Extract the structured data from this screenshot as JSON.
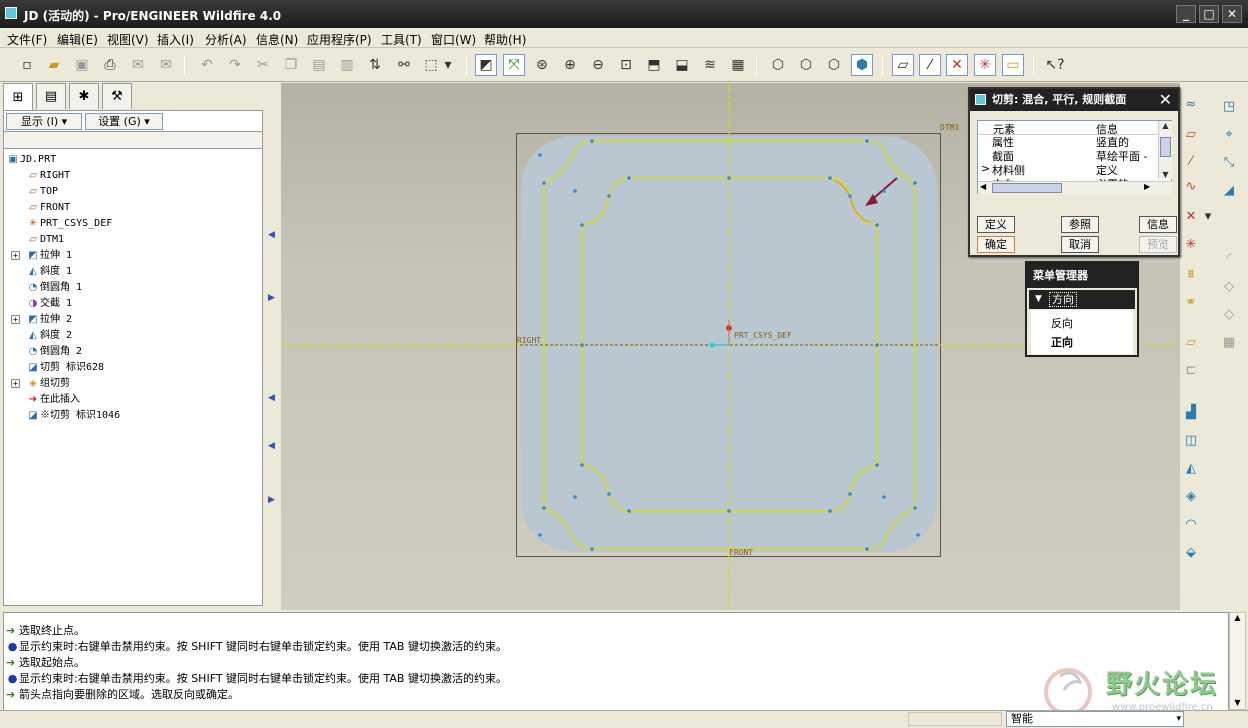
{
  "window": {
    "title": "JD (活动的) - Pro/ENGINEER Wildfire 4.0",
    "minimize": "_",
    "maximize": "□",
    "close": "✕"
  },
  "menu": [
    "文件(F)",
    "编辑(E)",
    "视图(V)",
    "插入(I)",
    "分析(A)",
    "信息(N)",
    "应用程序(P)",
    "工具(T)",
    "窗口(W)",
    "帮助(H)"
  ],
  "left_panel": {
    "show_button": "显示 (I) ▾",
    "settings_button": "设置 (G) ▾",
    "tree": [
      {
        "label": "JD.PRT",
        "icon": "part-icon",
        "glyph": "▣"
      },
      {
        "label": "RIGHT",
        "icon": "datum-plane-icon",
        "glyph": "▱"
      },
      {
        "label": "TOP",
        "icon": "datum-plane-icon",
        "glyph": "▱"
      },
      {
        "label": "FRONT",
        "icon": "datum-plane-icon",
        "glyph": "▱"
      },
      {
        "label": "PRT_CSYS_DEF",
        "icon": "csys-icon",
        "glyph": "✳"
      },
      {
        "label": "DTM1",
        "icon": "datum-plane-icon",
        "glyph": "▱"
      },
      {
        "label": "拉伸 1",
        "icon": "extrude-icon",
        "glyph": "◩",
        "expand": "+"
      },
      {
        "label": "斜度 1",
        "icon": "draft-icon",
        "glyph": "◭"
      },
      {
        "label": "倒圆角 1",
        "icon": "round-icon",
        "glyph": "◔"
      },
      {
        "label": "交截 1",
        "icon": "intersect-icon",
        "glyph": "◑"
      },
      {
        "label": "拉伸 2",
        "icon": "extrude-icon",
        "glyph": "◩",
        "expand": "+"
      },
      {
        "label": "斜度 2",
        "icon": "draft-icon",
        "glyph": "◭"
      },
      {
        "label": "倒圆角 2",
        "icon": "round-icon",
        "glyph": "◔"
      },
      {
        "label": "切剪 标识628",
        "icon": "cut-icon",
        "glyph": "◪"
      },
      {
        "label": "组切剪",
        "icon": "group-icon",
        "glyph": "◈",
        "expand": "+"
      },
      {
        "label": "在此插入",
        "icon": "insert-here-arrow-icon",
        "glyph": "➜"
      },
      {
        "label": "※切剪 标识1046",
        "icon": "cut-icon",
        "glyph": "◪"
      }
    ]
  },
  "viewport": {
    "labels": {
      "dtm1": "DTM1",
      "right": "RIGHT",
      "csys": "PRT_CSYS_DEF",
      "front": "FRONT"
    }
  },
  "dialog": {
    "title": "切剪: 混合, 平行, 规则截面",
    "col_element": "元素",
    "col_info": "信息",
    "rows": [
      {
        "element": "属性",
        "info": "竖直的"
      },
      {
        "element": "截面",
        "info": "草绘平面 -"
      },
      {
        "element": "材料侧",
        "info": "定义"
      },
      {
        "element": "方向",
        "info": "必需的"
      }
    ],
    "current_marker": ">",
    "buttons": {
      "define": "定义",
      "refs": "参照",
      "info": "信息",
      "ok": "确定",
      "cancel": "取消",
      "preview": "预览"
    }
  },
  "menu_manager": {
    "title": "菜单管理器",
    "submenu": "方向",
    "options": [
      "反向",
      "正向"
    ]
  },
  "messages": [
    {
      "type": "arrow",
      "text": "选取终止点。"
    },
    {
      "type": "bullet",
      "text": "显示约束时:右键单击禁用约束。按 SHIFT 键同时右键单击锁定约束。使用 TAB 键切换激活的约束。"
    },
    {
      "type": "arrow",
      "text": "选取起始点。"
    },
    {
      "type": "bullet",
      "text": "显示约束时:右键单击禁用约束。按 SHIFT 键同时右键单击锁定约束。使用 TAB 键切换激活的约束。"
    },
    {
      "type": "arrow",
      "text": "箭头点指向要删除的区域。选取反向或确定。"
    }
  ],
  "status": {
    "filter": "智能"
  },
  "watermark": {
    "text": "野火论坛",
    "url": "www.proewildfire.cn"
  },
  "colors": {
    "titlebar": "#222222",
    "viewport_bg": "#c6c4b6",
    "part_fill": "#b8c6d0",
    "sketch": "#e0e000",
    "accent": "#5cc7d8"
  }
}
